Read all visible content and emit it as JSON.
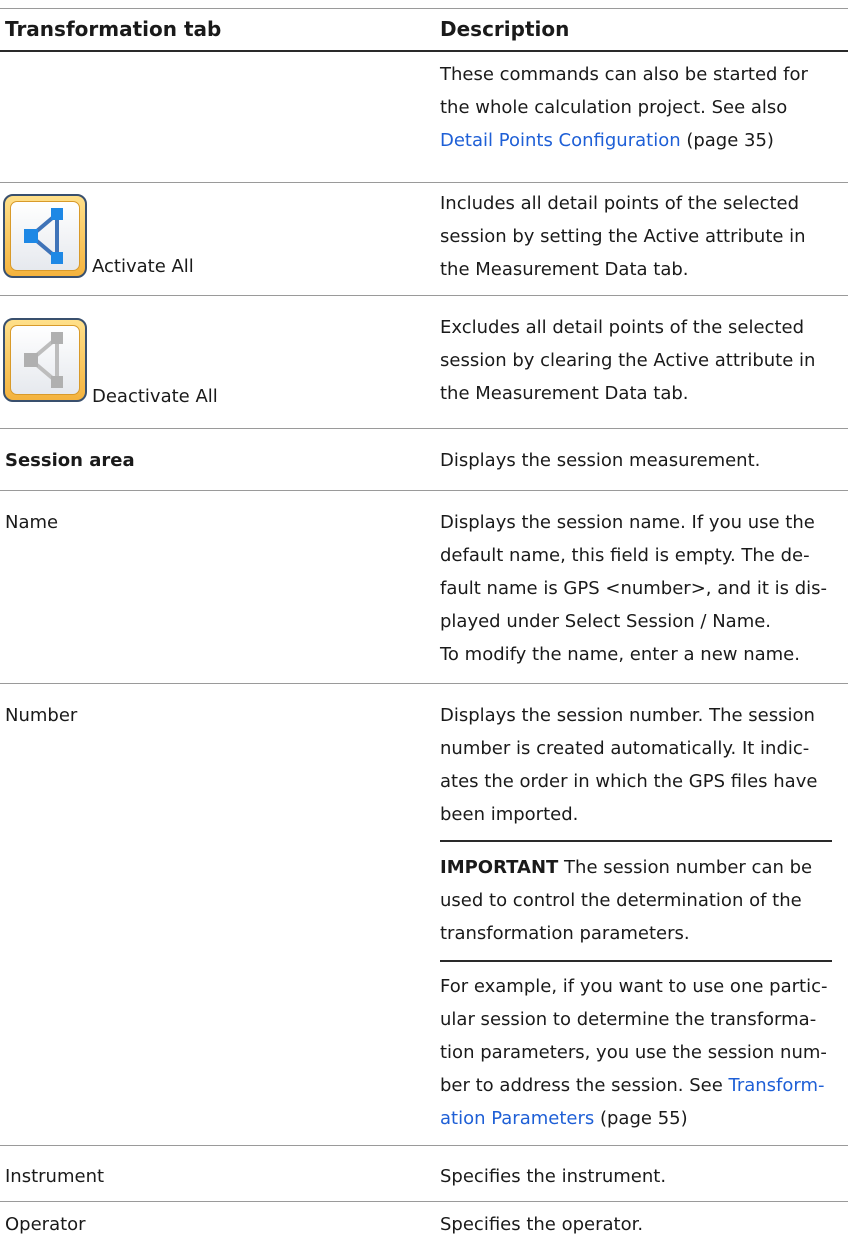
{
  "headers": {
    "left": "Transformation tab",
    "right": "Description"
  },
  "intro": {
    "line1": "These commands can also be started for",
    "line2": "the whole calculation project. See also",
    "link": "Detail Points Configuration",
    "suffix": " (page 35)"
  },
  "rows": {
    "activate": {
      "label": "Activate All",
      "icon": "activate-all-icon",
      "desc": [
        "Includes all detail points of the selected",
        "session by setting the Active attribute in",
        "the Measurement Data tab."
      ]
    },
    "deactivate": {
      "label": "Deactivate All",
      "icon": "deactivate-all-icon",
      "desc": [
        "Excludes all detail points of the selected",
        "session by clearing the Active attribute in",
        "the Measurement Data tab."
      ]
    },
    "session_area": {
      "label": "Session area",
      "desc": "Displays the session measurement."
    },
    "name": {
      "label": "Name",
      "desc": [
        "Displays the session name. If you use the",
        "default name, this field is empty. The de-",
        "fault name is GPS <number>, and it is dis-",
        "played under Select Session / Name.",
        "To modify the name, enter a new name."
      ]
    },
    "number": {
      "label": "Number",
      "desc": [
        "Displays the session number. The session",
        "number is created automatically. It indic-",
        "ates the order in which the GPS files have",
        "been imported."
      ],
      "important_label": "IMPORTANT",
      "important_line1": "  The session number can be",
      "important_lines": [
        "used to control the determination of the",
        "transformation parameters."
      ],
      "example_lines": [
        "For example, if you want to use one partic-",
        "ular session to determine the transforma-",
        "tion parameters, you use the session num-"
      ],
      "example_line4": "ber to address the session. See ",
      "example_link1": "Transform-",
      "example_link2": "ation Parameters",
      "example_suffix": " (page 55)"
    },
    "instrument": {
      "label": "Instrument",
      "desc": "Specifies the instrument."
    },
    "operator": {
      "label": "Operator",
      "desc": "Specifies the operator."
    }
  },
  "colors": {
    "link": "#1e5fd6",
    "rule": "#9a9a9a",
    "icon_accent": "#f4b33e"
  }
}
